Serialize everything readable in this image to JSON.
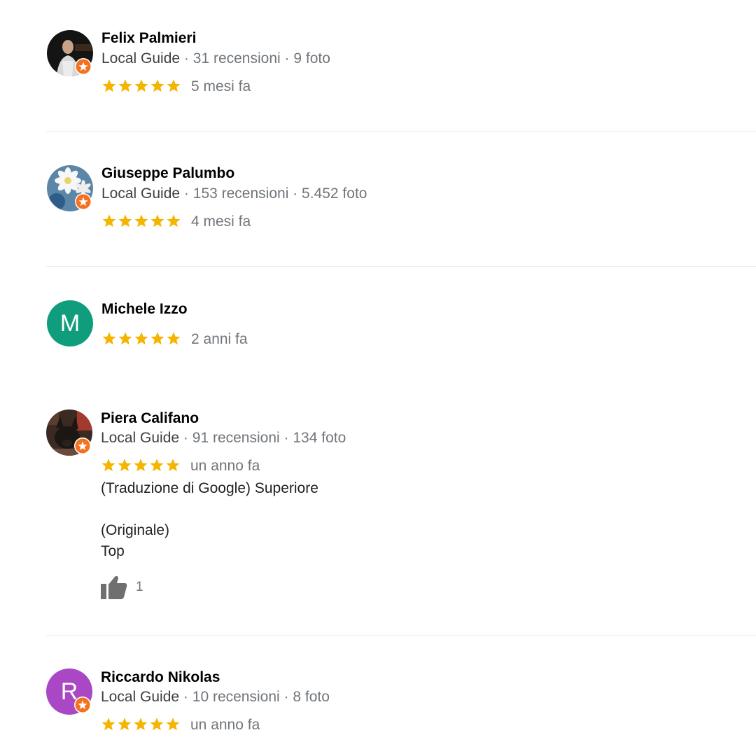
{
  "colors": {
    "star": "#f4b400",
    "badge": "#f4711f",
    "avatar_m": "#0f9d7e",
    "avatar_r": "#a947c4",
    "meta_gray": "#70757a"
  },
  "reviews": [
    {
      "name": "Felix Palmieri",
      "guide": "Local Guide",
      "dot1": "·",
      "reviews_count": "31 recensioni",
      "dot2": "·",
      "photos_count": "9 foto",
      "rating": 5,
      "date": "5 mesi fa",
      "avatar_icon": "photo-avatar-icon"
    },
    {
      "name": "Giuseppe Palumbo",
      "guide": "Local Guide",
      "dot1": "·",
      "reviews_count": "153 recensioni",
      "dot2": "·",
      "photos_count": "5.452 foto",
      "rating": 5,
      "date": "4 mesi fa",
      "avatar_icon": "flower-avatar-icon"
    },
    {
      "name": "Michele Izzo",
      "avatar_letter": "M",
      "rating": 5,
      "date": "2 anni fa"
    },
    {
      "name": "Piera Califano",
      "guide": "Local Guide",
      "dot1": "·",
      "reviews_count": "91 recensioni",
      "dot2": "·",
      "photos_count": "134 foto",
      "rating": 5,
      "date": "un anno fa",
      "translated_text": "(Traduzione di Google) Superiore",
      "original_label": "(Originale)",
      "original_text": "Top",
      "likes": "1",
      "like_icon": "thumbs-up-icon"
    },
    {
      "name": "Riccardo Nikolas",
      "avatar_letter": "R",
      "guide": "Local Guide",
      "dot1": "·",
      "reviews_count": "10 recensioni",
      "dot2": "·",
      "photos_count": "8 foto",
      "rating": 5,
      "date": "un anno fa"
    }
  ]
}
